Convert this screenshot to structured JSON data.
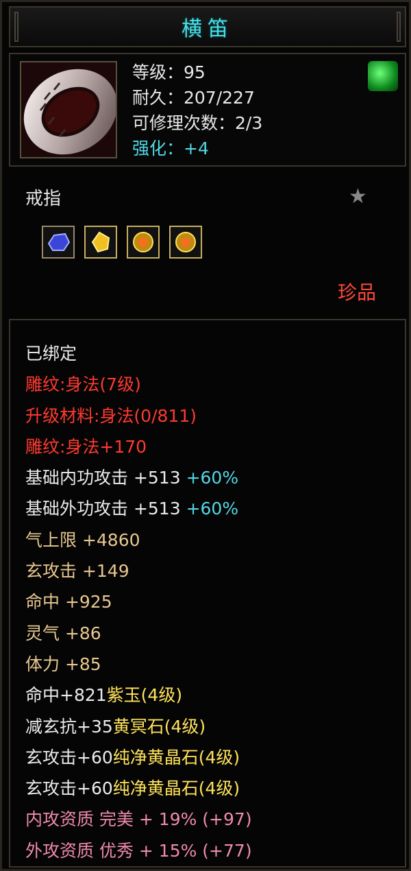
{
  "item": {
    "title": "横笛",
    "stats": {
      "level": "等级：95",
      "durability": "耐久：207/227",
      "repairs": "可修理次数：2/3",
      "enhance": "强化：+4"
    },
    "type": "戒指",
    "rarity": "珍品",
    "sockets": [
      "sapphire-gem-icon",
      "topaz-gem-icon",
      "yellow-crystal-icon",
      "yellow-crystal-icon"
    ]
  },
  "attributes": {
    "bound": "已绑定",
    "engrave": "雕纹:身法(7级)",
    "upgrade": "升级材料:身法(0/811)",
    "engrave_bonus": "雕纹:身法+170",
    "inner_attack": "基础内功攻击 +513 ",
    "inner_attack_pct": "+60%",
    "outer_attack": "基础外功攻击 +513 ",
    "outer_attack_pct": "+60%",
    "qi_limit": "气上限 +4860",
    "xuan_attack": "玄攻击 +149",
    "hit": "命中 +925",
    "spirit": "灵气 +86",
    "stamina": "体力 +85",
    "gem1_stat": "命中+821",
    "gem1_name": "紫玉(4级)",
    "gem2_stat": "减玄抗+35",
    "gem2_name": "黄冥石(4级)",
    "gem3_stat": "玄攻击+60",
    "gem3_name": "纯净黄晶石(4级)",
    "gem4_stat": "玄攻击+60",
    "gem4_name": "纯净黄晶石(4级)",
    "inner_quality": "内攻资质 完美 + 19% (+97)",
    "outer_quality": "外攻资质 优秀 + 15% (+77)"
  },
  "colors": {
    "title": "#48e0e8",
    "cyan": "#52d8e4",
    "red": "#ff3a30",
    "tan": "#e8c890",
    "pink": "#f08ab0",
    "gold": "#ffe25a"
  }
}
